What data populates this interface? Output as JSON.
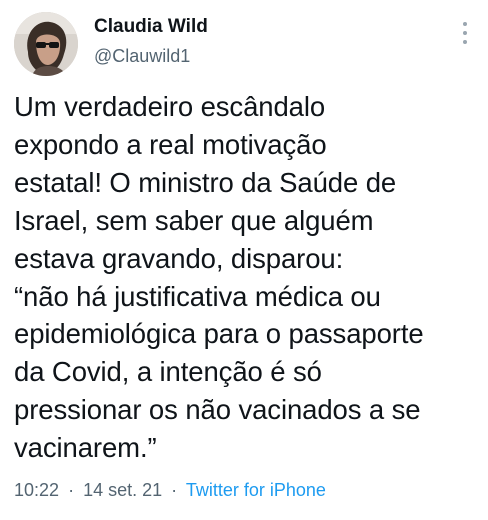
{
  "author": {
    "display_name": "Claudia Wild",
    "handle": "@Clauwild1"
  },
  "tweet": {
    "lines": [
      "Um verdadeiro escândalo",
      "expondo a real motivação",
      "estatal! O ministro da Saúde de",
      "Israel, sem saber que alguém",
      "estava gravando, disparou:",
      "“não há justificativa médica ou",
      "epidemiológica para o passaporte",
      "da Covid, a intenção é só",
      "pressionar os não vacinados a se",
      "vacinarem.”"
    ]
  },
  "meta": {
    "time": "10:22",
    "separator": "·",
    "date": "14 set. 21",
    "source": "Twitter for iPhone"
  },
  "icons": {
    "more": "more-vertical-icon",
    "avatar": "profile-photo"
  }
}
